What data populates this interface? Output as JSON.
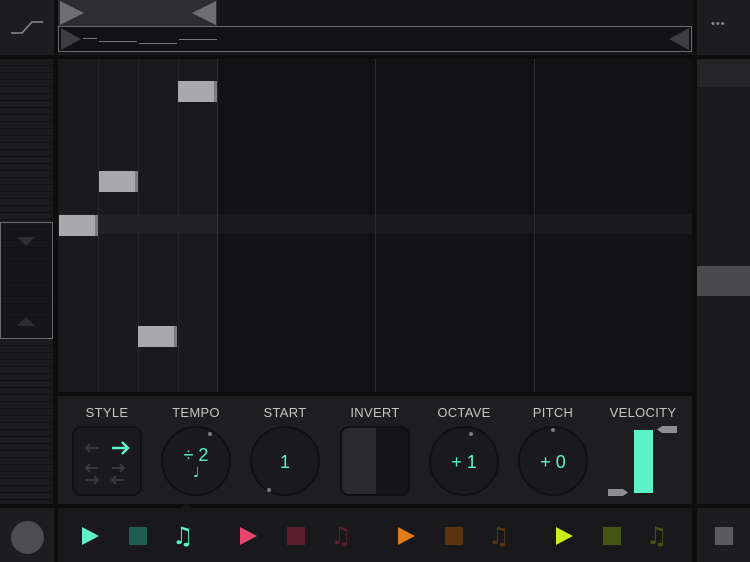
{
  "header": {
    "curve_icon": "envelope-curve-icon",
    "more_icon": "ellipsis-icon",
    "more_glyph": "•••"
  },
  "controls": {
    "style": {
      "label": "STYLE"
    },
    "tempo": {
      "label": "TEMPO",
      "value": "÷ 2",
      "note_glyph": "♩"
    },
    "start": {
      "label": "START",
      "value": "1"
    },
    "invert": {
      "label": "INVERT"
    },
    "octave": {
      "label": "OCTAVE",
      "value": "+ 1"
    },
    "pitch": {
      "label": "PITCH",
      "value": "+ 0"
    },
    "velocity": {
      "label": "VELOCITY",
      "level": 0.85
    }
  },
  "transport": {
    "groups": [
      {
        "color": "#5ef2c8",
        "stop_color": "#1f5d4f",
        "note_color": "#5ef2c8",
        "active": true
      },
      {
        "color": "#e8466d",
        "stop_color": "#5a1f2a",
        "note_color": "#5a1f2a",
        "active": false
      },
      {
        "color": "#e07a14",
        "stop_color": "#5a3510",
        "note_color": "#5a3510",
        "active": false
      },
      {
        "color": "#c8ef1a",
        "stop_color": "#475512",
        "note_color": "#475512",
        "active": false
      }
    ],
    "note_glyph": "♫"
  },
  "colors": {
    "accent": "#5ef2c8",
    "panel": "#1e1e20",
    "note": "#a9a9ab"
  }
}
